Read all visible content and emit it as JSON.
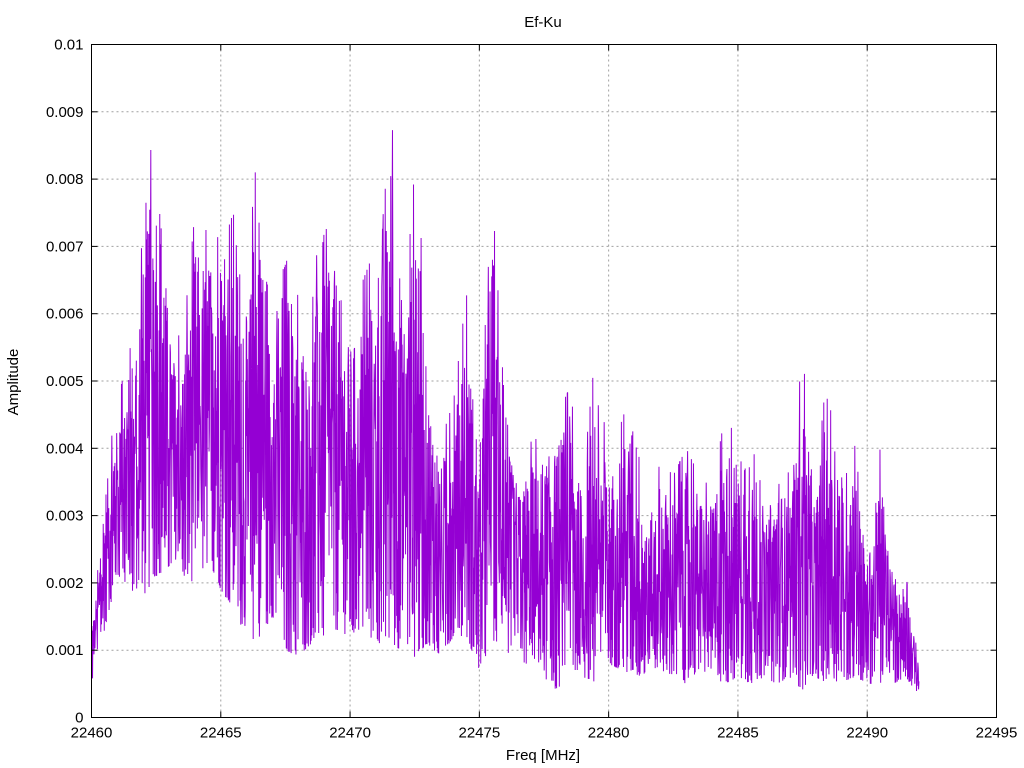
{
  "chart_data": {
    "type": "line",
    "title": "Ef-Ku",
    "xlabel": "Freq [MHz]",
    "ylabel": "Amplitude",
    "xlim": [
      22460,
      22495
    ],
    "ylim": [
      0,
      0.01
    ],
    "x_ticks": [
      "22460",
      "22465",
      "22470",
      "22475",
      "22480",
      "22485",
      "22490",
      "22495"
    ],
    "y_ticks": [
      "0",
      "0.001",
      "0.002",
      "0.003",
      "0.004",
      "0.005",
      "0.006",
      "0.007",
      "0.008",
      "0.009",
      "0.01"
    ],
    "grid": true,
    "series_color": "#9400d3",
    "series": [
      {
        "x_start": 22460,
        "x_step": 0.5,
        "min_envelope": [
          0.0005,
          0.0013,
          0.0021,
          0.0019,
          0.0018,
          0.0021,
          0.0022,
          0.0021,
          0.002,
          0.0023,
          0.0019,
          0.0016,
          0.0011,
          0.0012,
          0.0015,
          0.001,
          0.0009,
          0.0011,
          0.0012,
          0.0013,
          0.0012,
          0.0013,
          0.0011,
          0.0011,
          0.001,
          0.0009,
          0.0011,
          0.0009,
          0.0012,
          0.0012,
          0.0007,
          0.0011,
          0.001,
          0.0008,
          0.0008,
          0.0006,
          0.0004,
          0.0007,
          0.0006,
          0.0005,
          0.0008,
          0.0007,
          0.0006,
          0.0006,
          0.0007,
          0.0006,
          0.0005,
          0.0007,
          0.0006,
          0.0005,
          0.0006,
          0.0005,
          0.0006,
          0.0005,
          0.0006,
          0.0004,
          0.0006,
          0.0005,
          0.0005,
          0.0006,
          0.0005,
          0.0005,
          0.0005,
          0.0006,
          0.0003
        ],
        "max_envelope": [
          0.0013,
          0.0035,
          0.0047,
          0.0055,
          0.0072,
          0.0093,
          0.0062,
          0.0055,
          0.0075,
          0.0072,
          0.0084,
          0.0082,
          0.0065,
          0.0089,
          0.0061,
          0.0077,
          0.0062,
          0.006,
          0.0081,
          0.0071,
          0.006,
          0.0065,
          0.007,
          0.0094,
          0.007,
          0.009,
          0.0052,
          0.0041,
          0.0047,
          0.0063,
          0.0042,
          0.0078,
          0.0045,
          0.0037,
          0.0041,
          0.0042,
          0.0045,
          0.0049,
          0.0035,
          0.0055,
          0.0038,
          0.0044,
          0.005,
          0.0031,
          0.0038,
          0.0036,
          0.004,
          0.0036,
          0.0034,
          0.0045,
          0.0041,
          0.0048,
          0.003,
          0.004,
          0.0036,
          0.0054,
          0.0034,
          0.0054,
          0.004,
          0.0041,
          0.0025,
          0.004,
          0.0023,
          0.0021,
          0.0008
        ]
      }
    ]
  }
}
